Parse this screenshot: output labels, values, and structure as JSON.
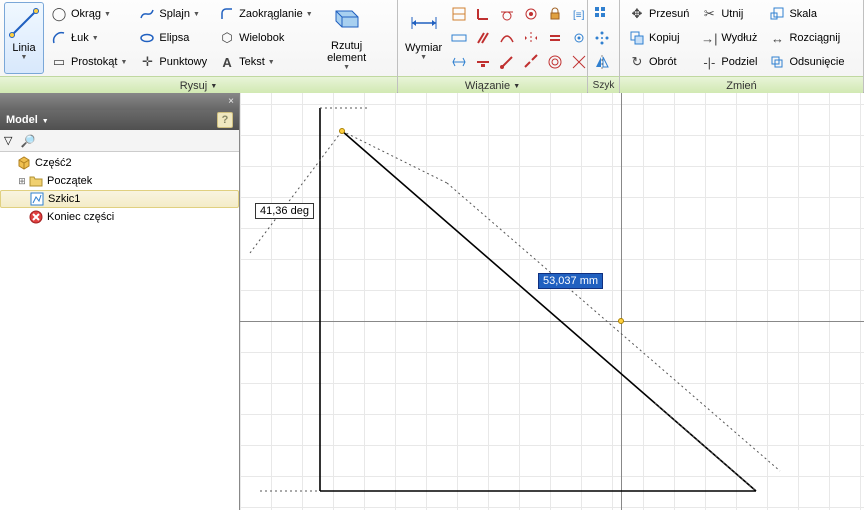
{
  "ribbon": {
    "draw": {
      "title": "Rysuj",
      "line": "Linia",
      "circle": "Okrąg",
      "arc": "Łuk",
      "rect": "Prostokąt",
      "spline": "Splajn",
      "ellipse": "Elipsa",
      "point": "Punktowy",
      "fillet": "Zaokrąglanie",
      "polygon": "Wielobok",
      "text": "Tekst",
      "project": "Rzutuj element"
    },
    "constraint": {
      "title": "Wiązanie",
      "dimension": "Wymiar"
    },
    "quick": {
      "title": "Szyk"
    },
    "modify": {
      "title": "Zmień",
      "move": "Przesuń",
      "copy": "Kopiuj",
      "rotate": "Obrót",
      "trim": "Utnij",
      "extend": "Wydłuż",
      "split": "Podziel",
      "scale": "Skala",
      "stretch": "Rozciągnij",
      "offset": "Odsunięcie"
    }
  },
  "panel": {
    "title": "Model",
    "tree": {
      "root": "Część2",
      "origin": "Początek",
      "sketch": "Szkic1",
      "end": "Koniec części"
    }
  },
  "canvas": {
    "angle": "41,36 deg",
    "length": "53,037 mm"
  }
}
